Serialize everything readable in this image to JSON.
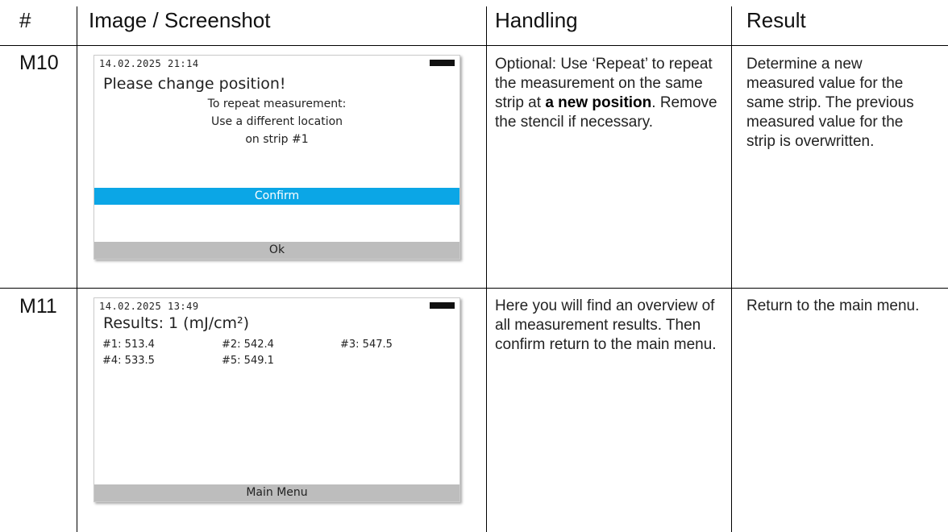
{
  "headers": {
    "num": "#",
    "image": "Image / Screenshot",
    "handling": "Handling",
    "result": "Result"
  },
  "rows": [
    {
      "id": "M10",
      "screen": {
        "datetime": "14.02.2025 21:14",
        "title": "Please change position!",
        "lines": [
          "To repeat measurement:",
          "Use a different location",
          "on strip #1"
        ],
        "selected_item": "Confirm",
        "softkey": "Ok"
      },
      "handling": {
        "part1": "Optional: Use ‘Repeat’ to repeat the measurement on the same strip at ",
        "bold1": "a new position",
        "part2": ". Remove the stencil if necessary."
      },
      "result": "Determine a new measured value for the same strip. The previous measured value for the strip is overwritten."
    },
    {
      "id": "M11",
      "screen": {
        "datetime": "14.02.2025 13:49",
        "title": "Results: 1 (mJ/cm²)",
        "results": [
          "#1: 513.4",
          "#2: 542.4",
          "#3: 547.5",
          "#4: 533.5",
          "#5: 549.1"
        ],
        "softkey": "Main Menu"
      },
      "handling": "Here you will find an overview of all measurement results. Then confirm return to the main menu.",
      "result": "Return to the main menu."
    }
  ],
  "colors": {
    "selection_bar": "#0ba6e6",
    "softkey_bar": "#bdbdbd"
  }
}
